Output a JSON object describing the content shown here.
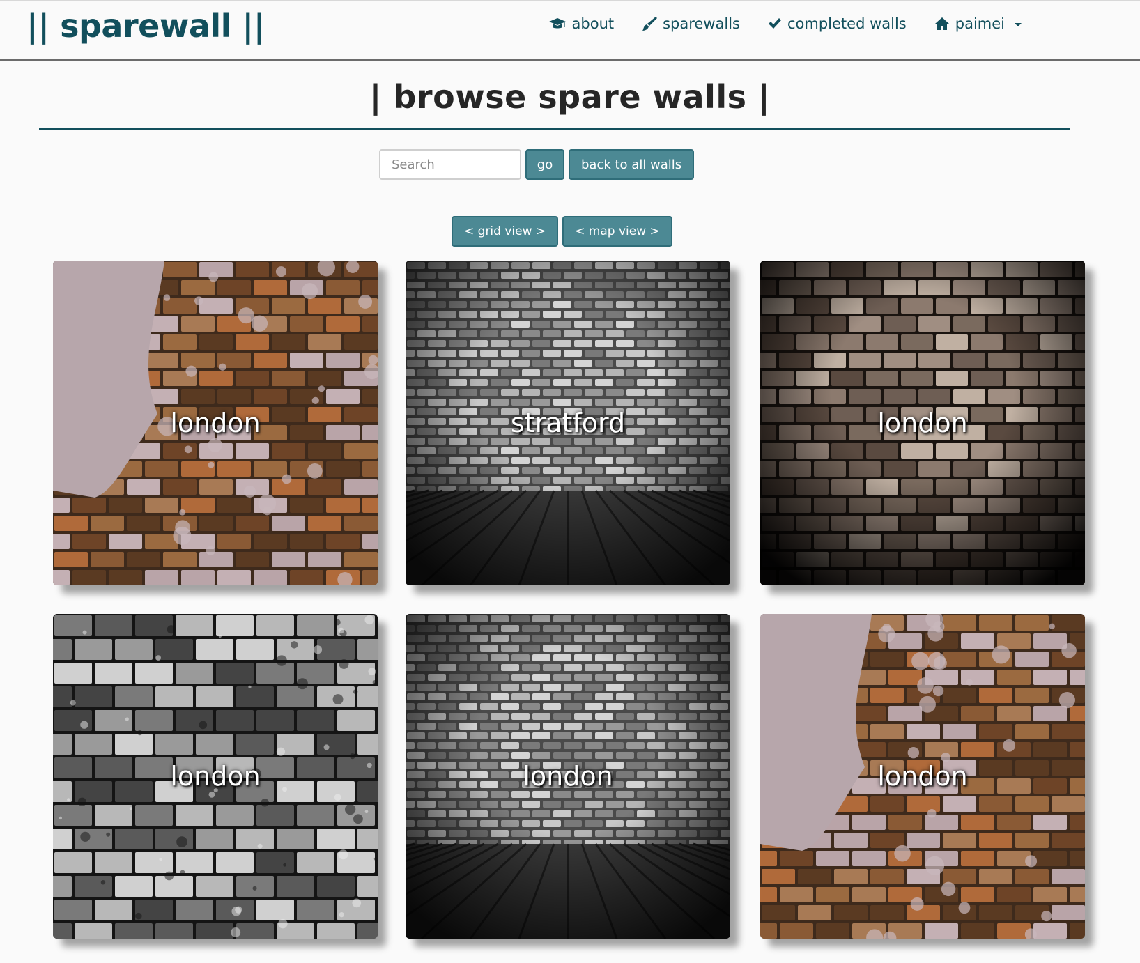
{
  "brand": "|| sparewall ||",
  "nav": {
    "about": "about",
    "sparewalls": "sparewalls",
    "completed": "completed walls",
    "user": "paimei"
  },
  "page": {
    "title": "| browse spare walls |"
  },
  "search": {
    "placeholder": "Search",
    "go_label": "go",
    "back_label": "back to all walls"
  },
  "views": {
    "grid_label": "< grid view >",
    "map_label": "< map view >"
  },
  "walls": [
    {
      "location": "london",
      "style": "rustic-brick"
    },
    {
      "location": "stratford",
      "style": "grey-room"
    },
    {
      "location": "london",
      "style": "dark-brick"
    },
    {
      "location": "london",
      "style": "bw-brick"
    },
    {
      "location": "london",
      "style": "grey-room"
    },
    {
      "location": "london",
      "style": "rustic-brick"
    }
  ],
  "colors": {
    "brand": "#124f5c",
    "button": "#4c8994",
    "rule": "#124f5c"
  }
}
